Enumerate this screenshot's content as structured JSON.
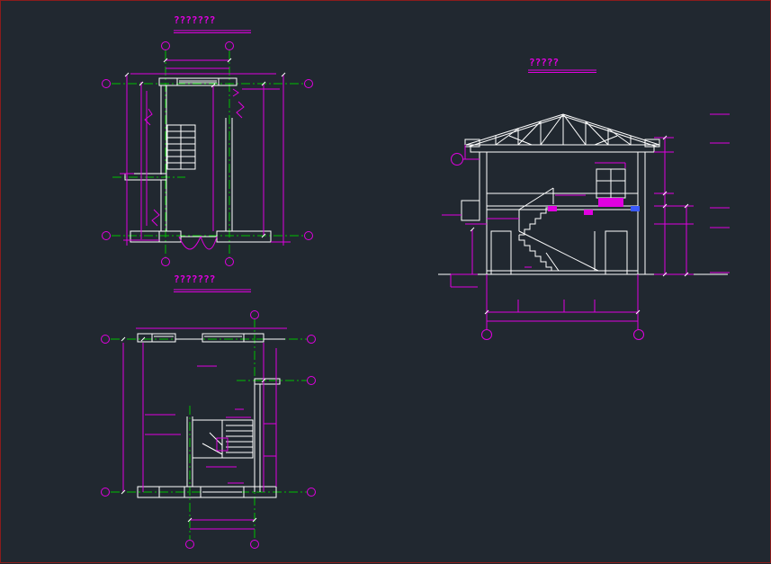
{
  "drawing": {
    "plan_upper_title": "???????",
    "plan_lower_title": "???????",
    "section_title": "?????"
  },
  "colors": {
    "background": "#212830",
    "wall": "#ffffff",
    "dimension": "#e000e0",
    "axis": "#00c000",
    "frame": "#8a1c1c"
  }
}
